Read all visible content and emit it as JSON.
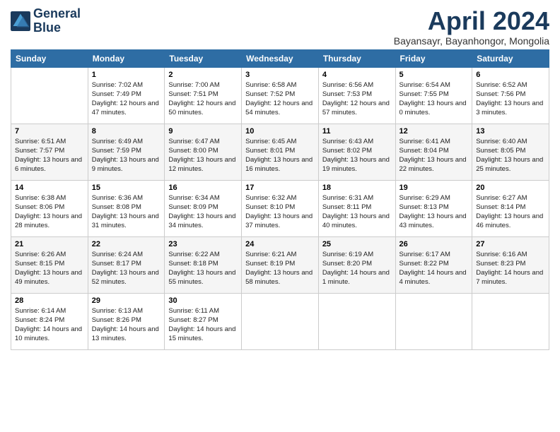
{
  "header": {
    "logo_line1": "General",
    "logo_line2": "Blue",
    "month_title": "April 2024",
    "subtitle": "Bayansayr, Bayanhongor, Mongolia"
  },
  "days_of_week": [
    "Sunday",
    "Monday",
    "Tuesday",
    "Wednesday",
    "Thursday",
    "Friday",
    "Saturday"
  ],
  "weeks": [
    [
      {
        "num": "",
        "sunrise": "",
        "sunset": "",
        "daylight": "",
        "empty": true
      },
      {
        "num": "1",
        "sunrise": "Sunrise: 7:02 AM",
        "sunset": "Sunset: 7:49 PM",
        "daylight": "Daylight: 12 hours and 47 minutes."
      },
      {
        "num": "2",
        "sunrise": "Sunrise: 7:00 AM",
        "sunset": "Sunset: 7:51 PM",
        "daylight": "Daylight: 12 hours and 50 minutes."
      },
      {
        "num": "3",
        "sunrise": "Sunrise: 6:58 AM",
        "sunset": "Sunset: 7:52 PM",
        "daylight": "Daylight: 12 hours and 54 minutes."
      },
      {
        "num": "4",
        "sunrise": "Sunrise: 6:56 AM",
        "sunset": "Sunset: 7:53 PM",
        "daylight": "Daylight: 12 hours and 57 minutes."
      },
      {
        "num": "5",
        "sunrise": "Sunrise: 6:54 AM",
        "sunset": "Sunset: 7:55 PM",
        "daylight": "Daylight: 13 hours and 0 minutes."
      },
      {
        "num": "6",
        "sunrise": "Sunrise: 6:52 AM",
        "sunset": "Sunset: 7:56 PM",
        "daylight": "Daylight: 13 hours and 3 minutes."
      }
    ],
    [
      {
        "num": "7",
        "sunrise": "Sunrise: 6:51 AM",
        "sunset": "Sunset: 7:57 PM",
        "daylight": "Daylight: 13 hours and 6 minutes."
      },
      {
        "num": "8",
        "sunrise": "Sunrise: 6:49 AM",
        "sunset": "Sunset: 7:59 PM",
        "daylight": "Daylight: 13 hours and 9 minutes."
      },
      {
        "num": "9",
        "sunrise": "Sunrise: 6:47 AM",
        "sunset": "Sunset: 8:00 PM",
        "daylight": "Daylight: 13 hours and 12 minutes."
      },
      {
        "num": "10",
        "sunrise": "Sunrise: 6:45 AM",
        "sunset": "Sunset: 8:01 PM",
        "daylight": "Daylight: 13 hours and 16 minutes."
      },
      {
        "num": "11",
        "sunrise": "Sunrise: 6:43 AM",
        "sunset": "Sunset: 8:02 PM",
        "daylight": "Daylight: 13 hours and 19 minutes."
      },
      {
        "num": "12",
        "sunrise": "Sunrise: 6:41 AM",
        "sunset": "Sunset: 8:04 PM",
        "daylight": "Daylight: 13 hours and 22 minutes."
      },
      {
        "num": "13",
        "sunrise": "Sunrise: 6:40 AM",
        "sunset": "Sunset: 8:05 PM",
        "daylight": "Daylight: 13 hours and 25 minutes."
      }
    ],
    [
      {
        "num": "14",
        "sunrise": "Sunrise: 6:38 AM",
        "sunset": "Sunset: 8:06 PM",
        "daylight": "Daylight: 13 hours and 28 minutes."
      },
      {
        "num": "15",
        "sunrise": "Sunrise: 6:36 AM",
        "sunset": "Sunset: 8:08 PM",
        "daylight": "Daylight: 13 hours and 31 minutes."
      },
      {
        "num": "16",
        "sunrise": "Sunrise: 6:34 AM",
        "sunset": "Sunset: 8:09 PM",
        "daylight": "Daylight: 13 hours and 34 minutes."
      },
      {
        "num": "17",
        "sunrise": "Sunrise: 6:32 AM",
        "sunset": "Sunset: 8:10 PM",
        "daylight": "Daylight: 13 hours and 37 minutes."
      },
      {
        "num": "18",
        "sunrise": "Sunrise: 6:31 AM",
        "sunset": "Sunset: 8:11 PM",
        "daylight": "Daylight: 13 hours and 40 minutes."
      },
      {
        "num": "19",
        "sunrise": "Sunrise: 6:29 AM",
        "sunset": "Sunset: 8:13 PM",
        "daylight": "Daylight: 13 hours and 43 minutes."
      },
      {
        "num": "20",
        "sunrise": "Sunrise: 6:27 AM",
        "sunset": "Sunset: 8:14 PM",
        "daylight": "Daylight: 13 hours and 46 minutes."
      }
    ],
    [
      {
        "num": "21",
        "sunrise": "Sunrise: 6:26 AM",
        "sunset": "Sunset: 8:15 PM",
        "daylight": "Daylight: 13 hours and 49 minutes."
      },
      {
        "num": "22",
        "sunrise": "Sunrise: 6:24 AM",
        "sunset": "Sunset: 8:17 PM",
        "daylight": "Daylight: 13 hours and 52 minutes."
      },
      {
        "num": "23",
        "sunrise": "Sunrise: 6:22 AM",
        "sunset": "Sunset: 8:18 PM",
        "daylight": "Daylight: 13 hours and 55 minutes."
      },
      {
        "num": "24",
        "sunrise": "Sunrise: 6:21 AM",
        "sunset": "Sunset: 8:19 PM",
        "daylight": "Daylight: 13 hours and 58 minutes."
      },
      {
        "num": "25",
        "sunrise": "Sunrise: 6:19 AM",
        "sunset": "Sunset: 8:20 PM",
        "daylight": "Daylight: 14 hours and 1 minute."
      },
      {
        "num": "26",
        "sunrise": "Sunrise: 6:17 AM",
        "sunset": "Sunset: 8:22 PM",
        "daylight": "Daylight: 14 hours and 4 minutes."
      },
      {
        "num": "27",
        "sunrise": "Sunrise: 6:16 AM",
        "sunset": "Sunset: 8:23 PM",
        "daylight": "Daylight: 14 hours and 7 minutes."
      }
    ],
    [
      {
        "num": "28",
        "sunrise": "Sunrise: 6:14 AM",
        "sunset": "Sunset: 8:24 PM",
        "daylight": "Daylight: 14 hours and 10 minutes."
      },
      {
        "num": "29",
        "sunrise": "Sunrise: 6:13 AM",
        "sunset": "Sunset: 8:26 PM",
        "daylight": "Daylight: 14 hours and 13 minutes."
      },
      {
        "num": "30",
        "sunrise": "Sunrise: 6:11 AM",
        "sunset": "Sunset: 8:27 PM",
        "daylight": "Daylight: 14 hours and 15 minutes."
      },
      {
        "num": "",
        "sunrise": "",
        "sunset": "",
        "daylight": "",
        "empty": true
      },
      {
        "num": "",
        "sunrise": "",
        "sunset": "",
        "daylight": "",
        "empty": true
      },
      {
        "num": "",
        "sunrise": "",
        "sunset": "",
        "daylight": "",
        "empty": true
      },
      {
        "num": "",
        "sunrise": "",
        "sunset": "",
        "daylight": "",
        "empty": true
      }
    ]
  ]
}
